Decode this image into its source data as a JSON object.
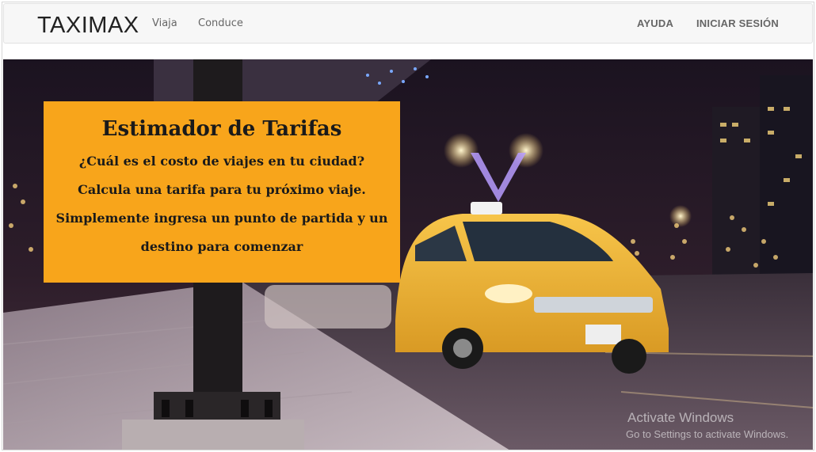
{
  "navbar": {
    "brand": "TAXIMAX",
    "links_left": [
      "Viaja",
      "Conduce"
    ],
    "links_right": [
      "AYUDA",
      "INICIAR SESIÓN"
    ]
  },
  "hero": {
    "image_desc_icon": "night-taxi-street-photo",
    "fare_box": {
      "title": "Estimador de Tarifas",
      "lines": [
        "¿Cuál es el costo de viajes en tu ciudad?",
        "Calcula una tarifa para tu próximo viaje.",
        "Simplemente ingresa un punto de partida y un",
        "destino para comenzar"
      ],
      "bg_color": "#f8a51b"
    }
  },
  "watermark": {
    "line1": "Activate Windows",
    "line2": "Go to Settings to activate Windows."
  }
}
